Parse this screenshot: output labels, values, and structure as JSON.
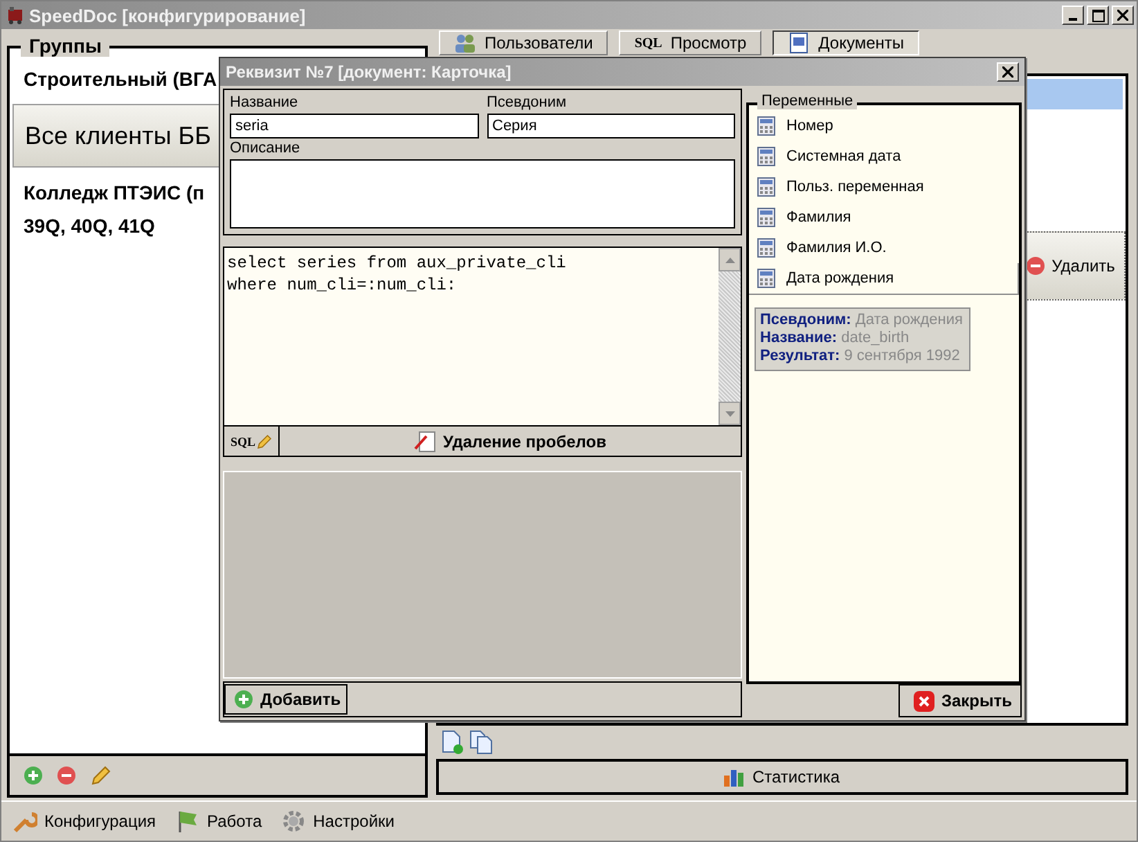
{
  "window": {
    "title": "SpeedDoc [конфигурирование]"
  },
  "groups": {
    "title": "Группы",
    "items": [
      {
        "lines": [
          "Строительный (ВГА"
        ],
        "selected": false
      },
      {
        "lines": [
          "Все клиенты ББ"
        ],
        "selected": true
      },
      {
        "lines": [
          "Колледж ПТЭИС (п",
          "39Q, 40Q, 41Q"
        ],
        "selected": false
      }
    ]
  },
  "tabs": [
    {
      "label": "Пользователи",
      "kind": "users",
      "selected": false
    },
    {
      "label": "Просмотр",
      "kind": "sql",
      "icon_text": "SQL",
      "selected": false
    },
    {
      "label": "Документы",
      "kind": "doc",
      "selected": true
    }
  ],
  "delete_button": "Удалить",
  "statistics_button": "Статистика",
  "bottom_tabs": [
    {
      "label": "Конфигурация",
      "kind": "config"
    },
    {
      "label": "Работа",
      "kind": "work"
    },
    {
      "label": "Настройки",
      "kind": "settings"
    }
  ],
  "dialog": {
    "title": "Реквизит №7 [документ: Карточка]",
    "name": {
      "label": "Название",
      "value": "seria"
    },
    "alias": {
      "label": "Псевдоним",
      "value": "Серия"
    },
    "description": {
      "label": "Описание"
    },
    "sql_lines": [
      "select series from aux_private_cli",
      "where num_cli=:num_cli:"
    ],
    "sql_button": "SQL",
    "trim_button": "Удаление пробелов",
    "add_button": "Добавить",
    "variables_title": "Переменные",
    "variables": [
      {
        "label": "Номер",
        "selected": false
      },
      {
        "label": "Системная дата",
        "selected": false
      },
      {
        "label": "Польз. переменная",
        "selected": false
      },
      {
        "label": "Фамилия",
        "selected": false
      },
      {
        "label": "Фамилия И.О.",
        "selected": false
      },
      {
        "label": "Дата рождения",
        "selected": true
      }
    ],
    "tooltip": [
      {
        "label": "Псевдоним:",
        "value": "Дата рождения"
      },
      {
        "label": "Название:",
        "value": "date_birth"
      },
      {
        "label": "Результат:",
        "value": "9 сентября 1992"
      }
    ],
    "close_button": "Закрыть"
  }
}
